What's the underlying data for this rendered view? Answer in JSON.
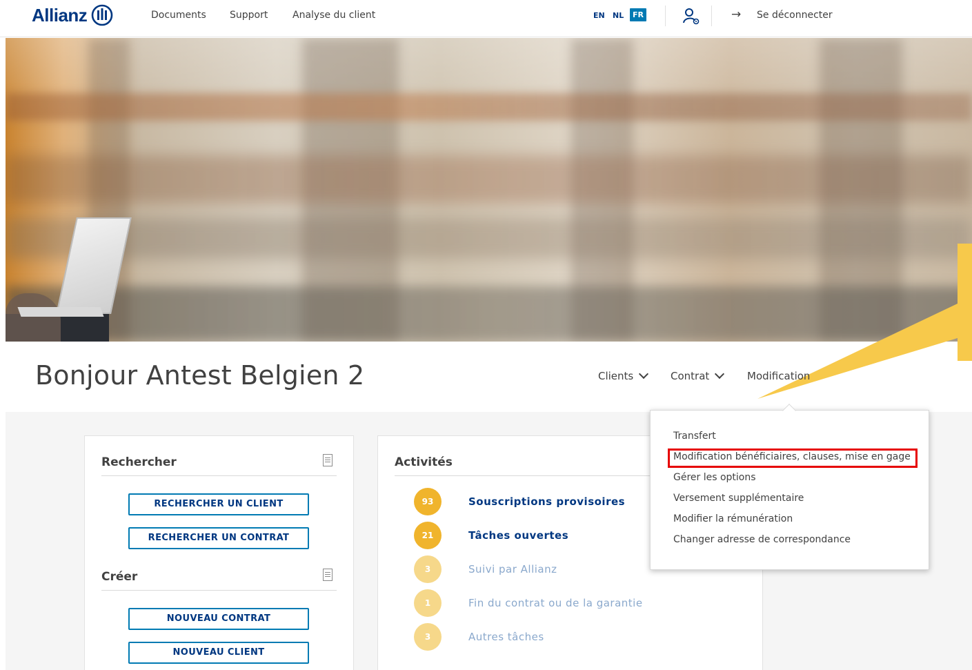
{
  "header": {
    "brand": "Allianz",
    "nav": [
      "Documents",
      "Support",
      "Analyse du client"
    ],
    "languages": [
      "EN",
      "NL",
      "FR"
    ],
    "active_language": "FR",
    "logout": "Se déconnecter"
  },
  "greeting": "Bonjour Antest Belgien 2",
  "filters": {
    "clients": "Clients",
    "contrat": "Contrat",
    "modification": "Modification"
  },
  "search_card": {
    "title": "Rechercher",
    "buttons": [
      "RECHERCHER UN CLIENT",
      "RECHERCHER UN CONTRAT"
    ]
  },
  "create_card": {
    "title": "Créer",
    "buttons": [
      "NOUVEAU CONTRAT",
      "NOUVEAU CLIENT"
    ]
  },
  "activities": {
    "title": "Activités",
    "items": [
      {
        "count": "93",
        "label": "Souscriptions provisoires"
      },
      {
        "count": "21",
        "label": "Tâches ouvertes"
      },
      {
        "count": "3",
        "label": "Suivi par Allianz"
      },
      {
        "count": "1",
        "label": "Fin du contrat ou de la garantie"
      },
      {
        "count": "3",
        "label": "Autres tâches"
      }
    ]
  },
  "dropdown": {
    "items": [
      "Transfert",
      "Modification bénéficiaires, clauses, mise en gage",
      "Gérer les options",
      "Versement supplémentaire",
      "Modifier la rémunération",
      "Changer adresse de correspondance"
    ],
    "highlighted": "Modification bénéficiaires, clauses, mise en gage"
  },
  "colors": {
    "brand_blue": "#003781",
    "accent_blue": "#007ab3",
    "badge_active": "#f0b42c",
    "badge_muted": "#f6d88a",
    "callout_yellow": "#f7c94b",
    "highlight_red": "#e60000"
  }
}
